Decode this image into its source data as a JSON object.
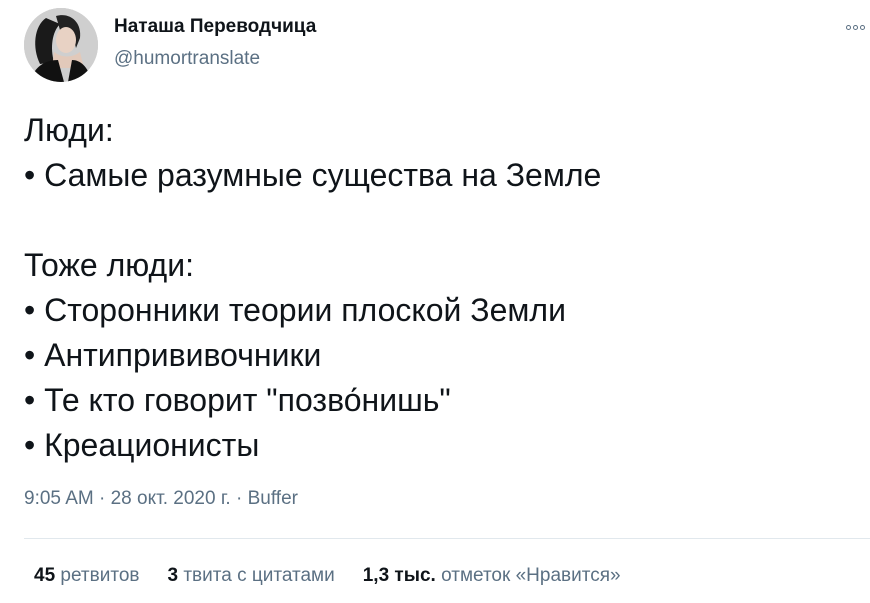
{
  "author": {
    "name": "Наташа Переводчица",
    "handle": "@humortranslate"
  },
  "tweet": {
    "lines": [
      "Люди:",
      "• Самые разумные существа на Земле",
      "",
      "Тоже люди:",
      "• Сторонники теории плоской Земли",
      "• Антипрививочники",
      "• Те кто говорит \"позво́нишь\"",
      "• Креационисты"
    ]
  },
  "meta": {
    "time": "9:05 AM",
    "separator": " · ",
    "date": "28 окт. 2020 г.",
    "source": "Buffer"
  },
  "stats": {
    "retweets_count": "45",
    "retweets_label": "ретвитов",
    "quotes_count": "3",
    "quotes_label": "твита с цитатами",
    "likes_count": "1,3 тыс.",
    "likes_label": "отметок «Нравится»"
  },
  "icons": {
    "more": "more-icon"
  },
  "colors": {
    "text": "#0f1419",
    "secondary": "#5b7083",
    "divider": "#e1e8ed"
  }
}
